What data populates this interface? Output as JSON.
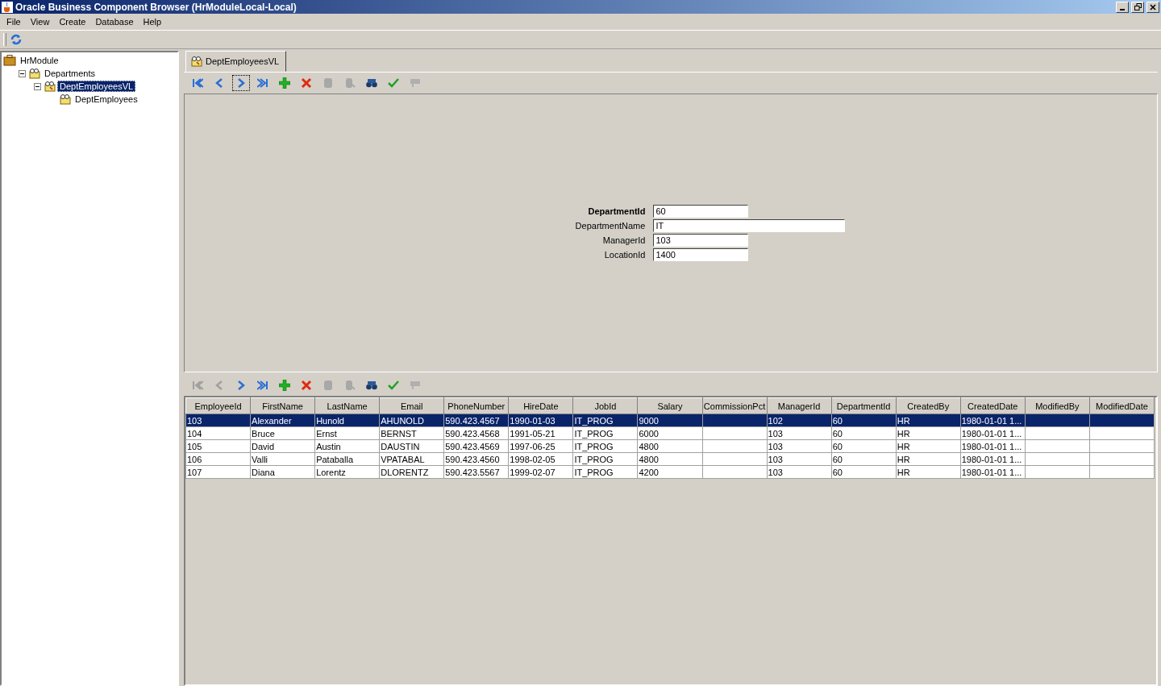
{
  "window": {
    "title": "Oracle Business Component Browser (HrModuleLocal-Local)"
  },
  "menu": [
    "File",
    "View",
    "Create",
    "Database",
    "Help"
  ],
  "toolbar": [
    {
      "kind": "refresh"
    }
  ],
  "tree": [
    {
      "label": "HrModule",
      "kind": "module",
      "selected": false,
      "children": [
        {
          "label": "Departments",
          "kind": "view",
          "selected": false,
          "expanded": true,
          "children": [
            {
              "label": "DeptEmployeesVL",
              "kind": "link",
              "selected": true,
              "expanded": true,
              "children": [
                {
                  "label": "DeptEmployees",
                  "kind": "view",
                  "selected": false
                }
              ]
            }
          ]
        }
      ]
    }
  ],
  "tabs": [
    {
      "label": "DeptEmployeesVL",
      "selected": true
    }
  ],
  "master_nav": [
    {
      "kind": "first",
      "disabled": false,
      "focused": false
    },
    {
      "kind": "prev",
      "disabled": false,
      "focused": false
    },
    {
      "kind": "next",
      "disabled": false,
      "focused": true
    },
    {
      "kind": "last",
      "disabled": false,
      "focused": false
    },
    {
      "kind": "add",
      "disabled": false,
      "focused": false
    },
    {
      "kind": "delete",
      "disabled": false,
      "focused": false
    },
    {
      "kind": "db",
      "disabled": true,
      "focused": false
    },
    {
      "kind": "db2",
      "disabled": true,
      "focused": false
    },
    {
      "kind": "find",
      "disabled": false,
      "focused": false
    },
    {
      "kind": "commit",
      "disabled": false,
      "focused": false
    },
    {
      "kind": "rollback",
      "disabled": true,
      "focused": false
    }
  ],
  "form": [
    {
      "label": "DepartmentId",
      "value": "60",
      "key": true,
      "wide": false
    },
    {
      "label": "DepartmentName",
      "value": "IT",
      "key": false,
      "wide": true
    },
    {
      "label": "ManagerId",
      "value": "103",
      "key": false,
      "wide": false
    },
    {
      "label": "LocationId",
      "value": "1400",
      "key": false,
      "wide": false
    }
  ],
  "detail_nav": [
    {
      "kind": "first",
      "disabled": true,
      "focused": false
    },
    {
      "kind": "prev",
      "disabled": true,
      "focused": false
    },
    {
      "kind": "next",
      "disabled": false,
      "focused": false
    },
    {
      "kind": "last",
      "disabled": false,
      "focused": false
    },
    {
      "kind": "add",
      "disabled": false,
      "focused": false
    },
    {
      "kind": "delete",
      "disabled": false,
      "focused": false
    },
    {
      "kind": "db",
      "disabled": true,
      "focused": false
    },
    {
      "kind": "db2",
      "disabled": true,
      "focused": false
    },
    {
      "kind": "find",
      "disabled": false,
      "focused": false
    },
    {
      "kind": "commit",
      "disabled": false,
      "focused": false
    },
    {
      "kind": "rollback",
      "disabled": true,
      "focused": false
    }
  ],
  "table": {
    "columns": [
      "EmployeeId",
      "FirstName",
      "LastName",
      "Email",
      "PhoneNumber",
      "HireDate",
      "JobId",
      "Salary",
      "CommissionPct",
      "ManagerId",
      "DepartmentId",
      "CreatedBy",
      "CreatedDate",
      "ModifiedBy",
      "ModifiedDate"
    ],
    "rows": [
      {
        "selected": true,
        "cells": [
          "103",
          "Alexander",
          "Hunold",
          "AHUNOLD",
          "590.423.4567",
          "1990-01-03",
          "IT_PROG",
          "9000",
          "",
          "102",
          "60",
          "HR",
          "1980-01-01 1...",
          "",
          ""
        ]
      },
      {
        "selected": false,
        "cells": [
          "104",
          "Bruce",
          "Ernst",
          "BERNST",
          "590.423.4568",
          "1991-05-21",
          "IT_PROG",
          "6000",
          "",
          "103",
          "60",
          "HR",
          "1980-01-01 1...",
          "",
          ""
        ]
      },
      {
        "selected": false,
        "cells": [
          "105",
          "David",
          "Austin",
          "DAUSTIN",
          "590.423.4569",
          "1997-06-25",
          "IT_PROG",
          "4800",
          "",
          "103",
          "60",
          "HR",
          "1980-01-01 1...",
          "",
          ""
        ]
      },
      {
        "selected": false,
        "cells": [
          "106",
          "Valli",
          "Pataballa",
          "VPATABAL",
          "590.423.4560",
          "1998-02-05",
          "IT_PROG",
          "4800",
          "",
          "103",
          "60",
          "HR",
          "1980-01-01 1...",
          "",
          ""
        ]
      },
      {
        "selected": false,
        "cells": [
          "107",
          "Diana",
          "Lorentz",
          "DLORENTZ",
          "590.423.5567",
          "1999-02-07",
          "IT_PROG",
          "4200",
          "",
          "103",
          "60",
          "HR",
          "1980-01-01 1...",
          "",
          ""
        ]
      }
    ]
  }
}
